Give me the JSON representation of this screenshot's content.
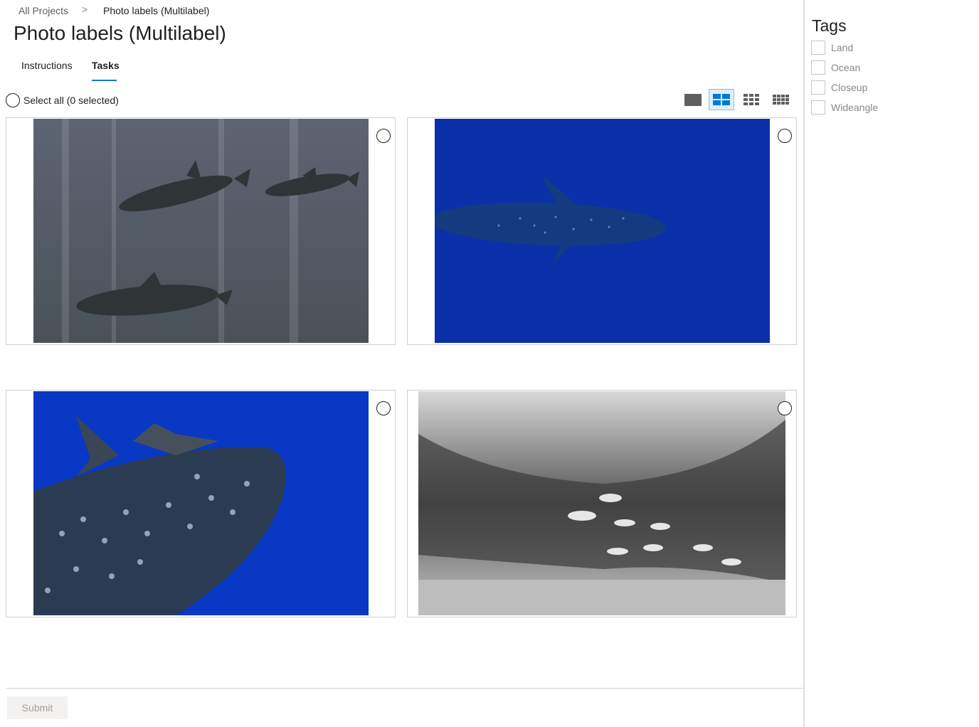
{
  "breadcrumb": {
    "root": "All Projects",
    "separator": ">",
    "current": "Photo labels (Multilabel)"
  },
  "page_title": "Photo labels (Multilabel)",
  "tabs": [
    {
      "label": "Instructions",
      "active": false
    },
    {
      "label": "Tasks",
      "active": true
    }
  ],
  "select_all": {
    "label": "Select all (0 selected)",
    "selected_count": 0
  },
  "view_modes": [
    {
      "icon": "single-view-icon",
      "active": false
    },
    {
      "icon": "grid-2x2-icon",
      "active": true
    },
    {
      "icon": "grid-3x3-icon",
      "active": false
    },
    {
      "icon": "grid-4x4-icon",
      "active": false
    }
  ],
  "images": [
    {
      "subject": "dolphins-underwater",
      "selected": false
    },
    {
      "subject": "whale-shark-blue",
      "selected": false
    },
    {
      "subject": "whale-shark-closeup",
      "selected": false
    },
    {
      "subject": "fish-school-grayscale",
      "selected": false
    }
  ],
  "tags_panel": {
    "title": "Tags",
    "tags": [
      {
        "label": "Land",
        "checked": false
      },
      {
        "label": "Ocean",
        "checked": false
      },
      {
        "label": "Closeup",
        "checked": false
      },
      {
        "label": "Wideangle",
        "checked": false
      }
    ]
  },
  "submit": {
    "label": "Submit",
    "enabled": false
  },
  "colors": {
    "accent": "#0078d4",
    "active_view_bg": "#e1effa"
  }
}
